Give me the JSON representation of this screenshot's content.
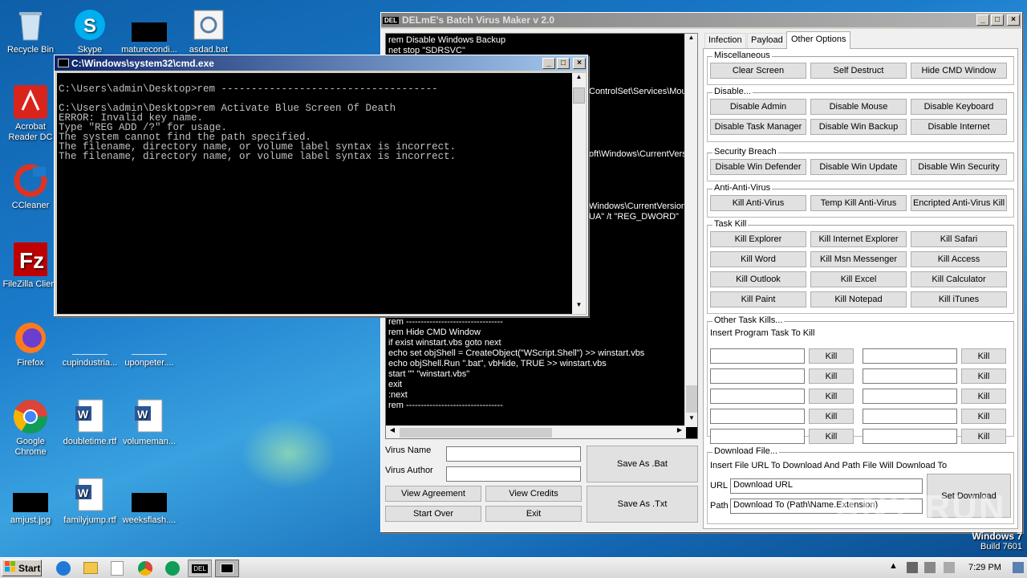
{
  "desktop": {
    "icons": [
      {
        "label": "Recycle Bin"
      },
      {
        "label": "Skype"
      },
      {
        "label": "maturecondi..."
      },
      {
        "label": "asdad.bat"
      },
      {
        "label": "Acrobat Reader DC"
      },
      {
        "label": "CCleaner"
      },
      {
        "label": "FileZilla Client"
      },
      {
        "label": "Firefox"
      },
      {
        "label": "cupindustria..."
      },
      {
        "label": "uponpeter...."
      },
      {
        "label": "Google Chrome"
      },
      {
        "label": "doubletime.rtf"
      },
      {
        "label": "volumeman..."
      },
      {
        "label": "amjust.jpg"
      },
      {
        "label": "familyjump.rtf"
      },
      {
        "label": "weeksflash...."
      }
    ]
  },
  "virus_maker": {
    "title": "DELmE's Batch Virus Maker v 2.0",
    "editor_lines_top": [
      "rem Disable Windows Backup",
      "net stop \"SDRSVC\""
    ],
    "editor_fragments": [
      "ControlSet\\Services\\Mou",
      "oft\\Windows\\CurrentVers",
      "Windows\\CurrentVersion\\F",
      "UA\" /t \"REG_DWORD\""
    ],
    "editor_lines_bottom": [
      "rem ---------------------------------",
      "rem Hide CMD Window",
      "if exist winstart.vbs goto next",
      "echo set objShell = CreateObject(\"WScript.Shell\") >> winstart.vbs",
      "echo objShell.Run \".bat\", vbHide, TRUE >> winstart.vbs",
      "start \"\" \"winstart.vbs\"",
      "exit",
      ":next",
      "rem ---------------------------------"
    ],
    "virus_name_label": "Virus Name",
    "virus_author_label": "Virus Author",
    "virus_name_value": "",
    "virus_author_value": "",
    "buttons": {
      "save_bat": "Save As .Bat",
      "save_txt": "Save As .Txt",
      "view_agreement": "View Agreement",
      "view_credits": "View Credits",
      "start_over": "Start Over",
      "exit": "Exit"
    },
    "tabs": [
      "Infection",
      "Payload",
      "Other Options"
    ],
    "misc": {
      "title": "Miscellaneous",
      "buttons": [
        "Clear Screen",
        "Self Destruct",
        "Hide CMD Window"
      ]
    },
    "disable": {
      "title": "Disable...",
      "buttons": [
        "Disable Admin",
        "Disable Mouse",
        "Disable Keyboard",
        "Disable Task Manager",
        "Disable Win Backup",
        "Disable Internet"
      ]
    },
    "security": {
      "title": "Security Breach",
      "buttons": [
        "Disable Win Defender",
        "Disable Win Update",
        "Disable Win Security"
      ]
    },
    "antiav": {
      "title": "Anti-Anti-Virus",
      "buttons": [
        "Kill Anti-Virus",
        "Temp Kill Anti-Virus",
        "Encripted Anti-Virus Kill"
      ]
    },
    "taskkill": {
      "title": "Task Kill",
      "buttons": [
        "Kill Explorer",
        "Kill Internet Explorer",
        "Kill Safari",
        "Kill Word",
        "Kill Msn Messenger",
        "Kill Access",
        "Kill Outlook",
        "Kill Excel",
        "Kill Calculator",
        "Kill Paint",
        "Kill Notepad",
        "Kill iTunes"
      ]
    },
    "other_kills": {
      "title": "Other Task Kills...",
      "subtitle": "Insert Program Task To Kill",
      "kill_label": "Kill"
    },
    "download": {
      "title": "Download File...",
      "subtitle": "Insert File URL To Download And Path File Will Download To",
      "url_label": "URL",
      "path_label": "Path",
      "url_value": "Download URL",
      "path_value": "Download To (Path\\Name.Extension)",
      "set_button": "Set Download"
    }
  },
  "cmd": {
    "title": "C:\\Windows\\system32\\cmd.exe",
    "lines": [
      "",
      "C:\\Users\\admin\\Desktop>rem ------------------------------------",
      "",
      "C:\\Users\\admin\\Desktop>rem Activate Blue Screen Of Death",
      "ERROR: Invalid key name.",
      "Type \"REG ADD /?\" for usage.",
      "The system cannot find the path specified.",
      "The filename, directory name, or volume label syntax is incorrect.",
      "The filename, directory name, or volume label syntax is incorrect."
    ]
  },
  "watermark": {
    "os": "Windows 7",
    "build": "Build 7601",
    "brand": "ANY RUN"
  },
  "taskbar": {
    "start_label": "Start",
    "clock": "7:29 PM",
    "del_label": "DEL"
  }
}
